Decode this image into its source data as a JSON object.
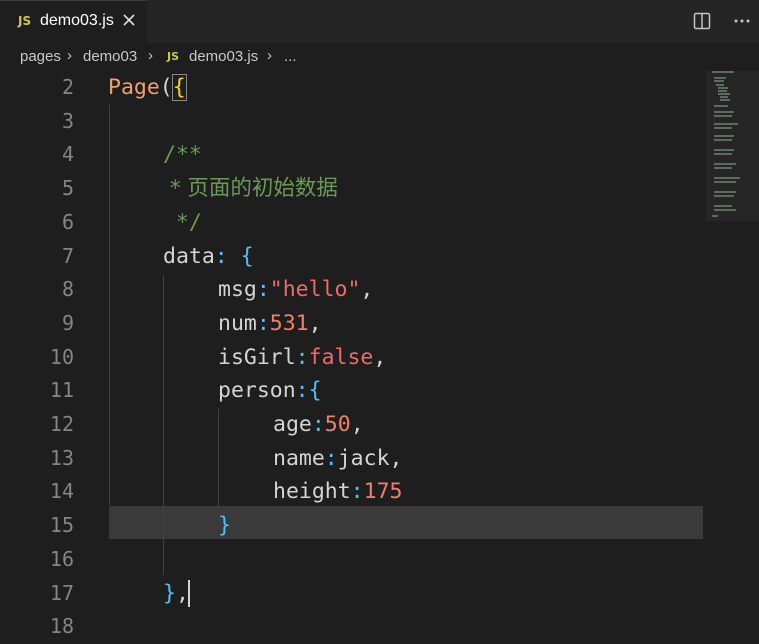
{
  "tab": {
    "badge": "JS",
    "filename": "demo03.js"
  },
  "breadcrumb": {
    "items": [
      "pages",
      "demo03"
    ],
    "file_badge": "JS",
    "file": "demo03.js",
    "more": "..."
  },
  "editor": {
    "line_numbers": [
      "2",
      "3",
      "4",
      "5",
      "6",
      "7",
      "8",
      "9",
      "10",
      "11",
      "12",
      "13",
      "14",
      "15",
      "16",
      "17",
      "18"
    ],
    "lines": {
      "l2_fn": "Page",
      "l2_paren": "(",
      "l2_brace": "{",
      "l4": "/**",
      "l5": " * 页面的初始数据",
      "l6": " */",
      "l7_key": "data",
      "l7_colon": ":",
      "l7_brace": " {",
      "l8_key": "msg",
      "l8_colon": ":",
      "l8_val": "\"hello\"",
      "l8_comma": ",",
      "l9_key": "num",
      "l9_colon": ":",
      "l9_val": "531",
      "l9_comma": ",",
      "l10_key": "isGirl",
      "l10_colon": ":",
      "l10_val": "false",
      "l10_comma": ",",
      "l11_key": "person",
      "l11_colon": ":",
      "l11_brace": "{",
      "l12_key": "age",
      "l12_colon": ":",
      "l12_val": "50",
      "l12_comma": ",",
      "l13_key": "name",
      "l13_colon": ":",
      "l13_val": "jack",
      "l13_comma": ",",
      "l14_key": "height",
      "l14_colon": ":",
      "l14_val": "175",
      "l15": "}",
      "l17_brace": "}",
      "l17_comma": ","
    }
  },
  "icons": {
    "close": "close-icon",
    "split": "split-editor-icon",
    "more": "more-actions-icon"
  }
}
